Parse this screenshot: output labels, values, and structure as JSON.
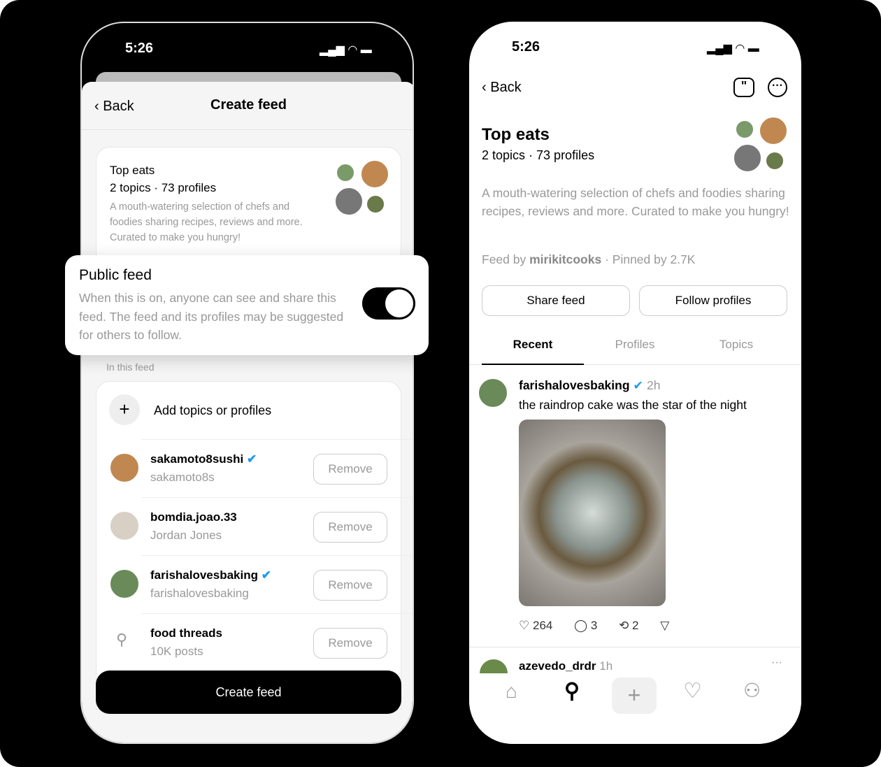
{
  "left": {
    "status_time": "5:26",
    "header": {
      "back": "Back",
      "title": "Create feed"
    },
    "feed": {
      "name": "Top eats",
      "meta": "2 topics · 73 profiles",
      "description": "A mouth-watering selection of chefs and foodies sharing recipes, reviews and more. Curated to make you hungry!"
    },
    "public": {
      "title": "Public feed",
      "description": "When this is on, anyone can see and share this feed. The feed and its profiles may be suggested for others to follow.",
      "enabled": true
    },
    "section_label": "In this feed",
    "add_label": "Add topics or profiles",
    "items": [
      {
        "name": "sakamoto8sushi",
        "sub": "sakamoto8s",
        "verified": true,
        "type": "profile"
      },
      {
        "name": "bomdia.joao.33",
        "sub": "Jordan Jones",
        "verified": false,
        "type": "profile"
      },
      {
        "name": "farishalovesbaking",
        "sub": "farishalovesbaking",
        "verified": true,
        "type": "profile"
      },
      {
        "name": "food threads",
        "sub": "10K posts",
        "verified": false,
        "type": "topic"
      }
    ],
    "remove_label": "Remove",
    "create_button": "Create feed"
  },
  "right": {
    "status_time": "5:26",
    "back": "Back",
    "feed": {
      "name": "Top eats",
      "meta": "2 topics · 73 profiles",
      "description": "A mouth-watering selection of chefs and foodies sharing recipes, reviews and more. Curated to make you hungry!",
      "by_prefix": "Feed by",
      "author": "mirikitcooks",
      "pinned": "Pinned by 2.7K"
    },
    "share_button": "Share feed",
    "follow_button": "Follow profiles",
    "tabs": [
      "Recent",
      "Profiles",
      "Topics"
    ],
    "active_tab": 0,
    "post": {
      "user": "farishalovesbaking",
      "time": "2h",
      "text": "the raindrop cake was the star of the night",
      "likes": "264",
      "replies": "3",
      "reposts": "2"
    },
    "next_post": {
      "user": "azevedo_drdr",
      "time": "1h"
    }
  }
}
